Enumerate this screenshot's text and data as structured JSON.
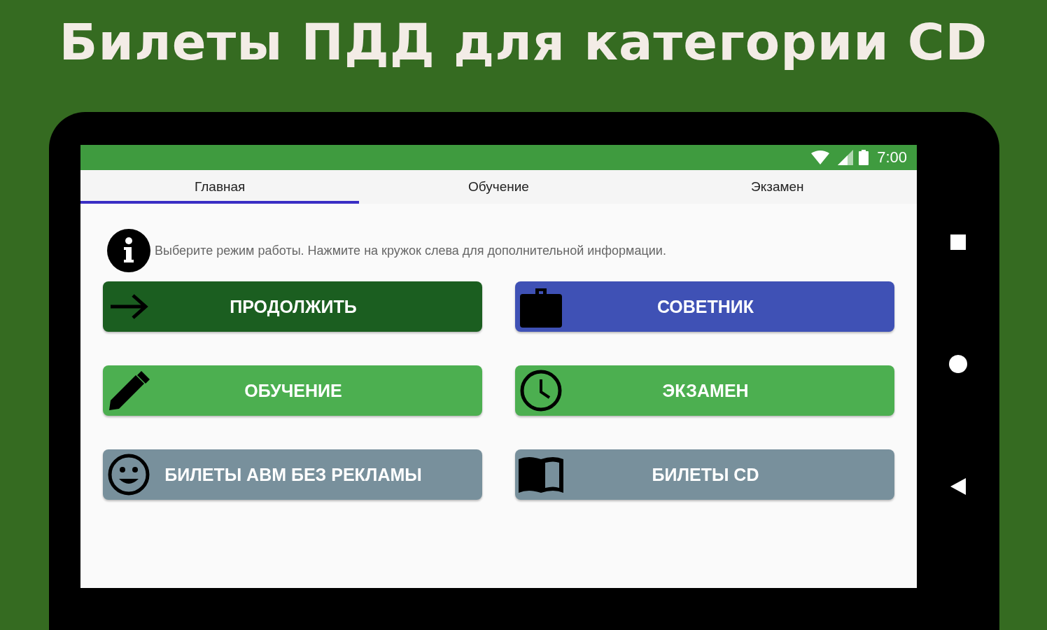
{
  "headline": "Билеты ПДД для категории CD",
  "status_bar": {
    "time": "7:00"
  },
  "tabs": [
    {
      "label": "Главная",
      "selected": true
    },
    {
      "label": "Обучение",
      "selected": false
    },
    {
      "label": "Экзамен",
      "selected": false
    }
  ],
  "info_text": "Выберите режим работы. Нажмите на кружок слева для дополнительной информации.",
  "buttons": [
    {
      "label": "ПРОДОЛЖИТЬ",
      "kind": "arrow",
      "color": "#1b5e20"
    },
    {
      "label": "СОВЕТНИК",
      "kind": "briefcase",
      "color": "#3f51b5"
    },
    {
      "label": "ОБУЧЕНИЕ",
      "kind": "pencil",
      "color": "#4caf50"
    },
    {
      "label": "ЭКЗАМЕН",
      "kind": "clock",
      "color": "#4caf50"
    },
    {
      "label": "БИЛЕТЫ АВМ БЕЗ РЕКЛАМЫ",
      "kind": "smiley",
      "color": "#78909c"
    },
    {
      "label": "БИЛЕТЫ CD",
      "kind": "book",
      "color": "#78909c"
    }
  ]
}
